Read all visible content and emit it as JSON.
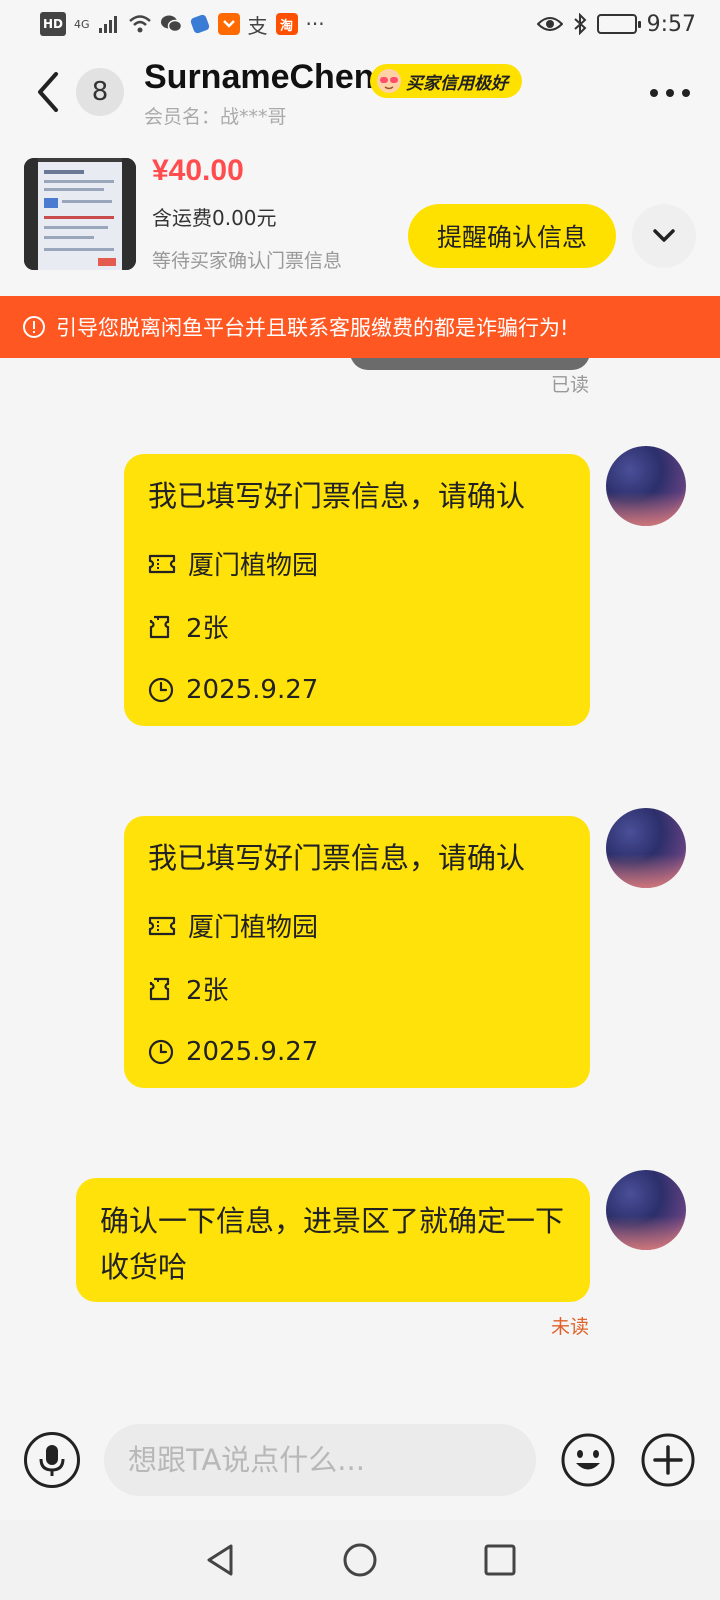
{
  "status_bar": {
    "hd_label": "HD",
    "network_label": "4G",
    "app_icon_label": "支",
    "taobao_label": "淘",
    "dots": "···",
    "time": "9:57"
  },
  "header": {
    "back_icon": "chevron-left-icon",
    "unread_count": "8",
    "user_name": "SurnameChen",
    "credit_badge": "买家信用极好",
    "member_name": "会员名：战***哥",
    "more_icon": "more-horizontal-icon"
  },
  "product": {
    "price": "¥40.00",
    "shipping": "含运费0.00元",
    "status": "等待买家确认门票信息",
    "remind_button": "提醒确认信息",
    "expand_icon": "chevron-down-icon"
  },
  "warning": {
    "text": "引导您脱离闲鱼平台并且联系客服缴费的都是诈骗行为!"
  },
  "chat": {
    "prev_read_status": "已读",
    "messages": [
      {
        "type": "ticket-card",
        "title": "我已填写好门票信息，请确认",
        "venue": "厦门植物园",
        "quantity": "2张",
        "date": "2025.9.27"
      },
      {
        "type": "ticket-card",
        "title": "我已填写好门票信息，请确认",
        "venue": "厦门植物园",
        "quantity": "2张",
        "date": "2025.9.27"
      },
      {
        "type": "text",
        "text": "确认一下信息，进景区了就确定一下收货哈",
        "status": "未读"
      }
    ]
  },
  "input_bar": {
    "placeholder": "想跟TA说点什么..."
  },
  "colors": {
    "accent_yellow": "#ffe20a",
    "warning_orange": "#ff5722",
    "price_red": "#ff4d4f",
    "unread_orange": "#e0622a"
  }
}
